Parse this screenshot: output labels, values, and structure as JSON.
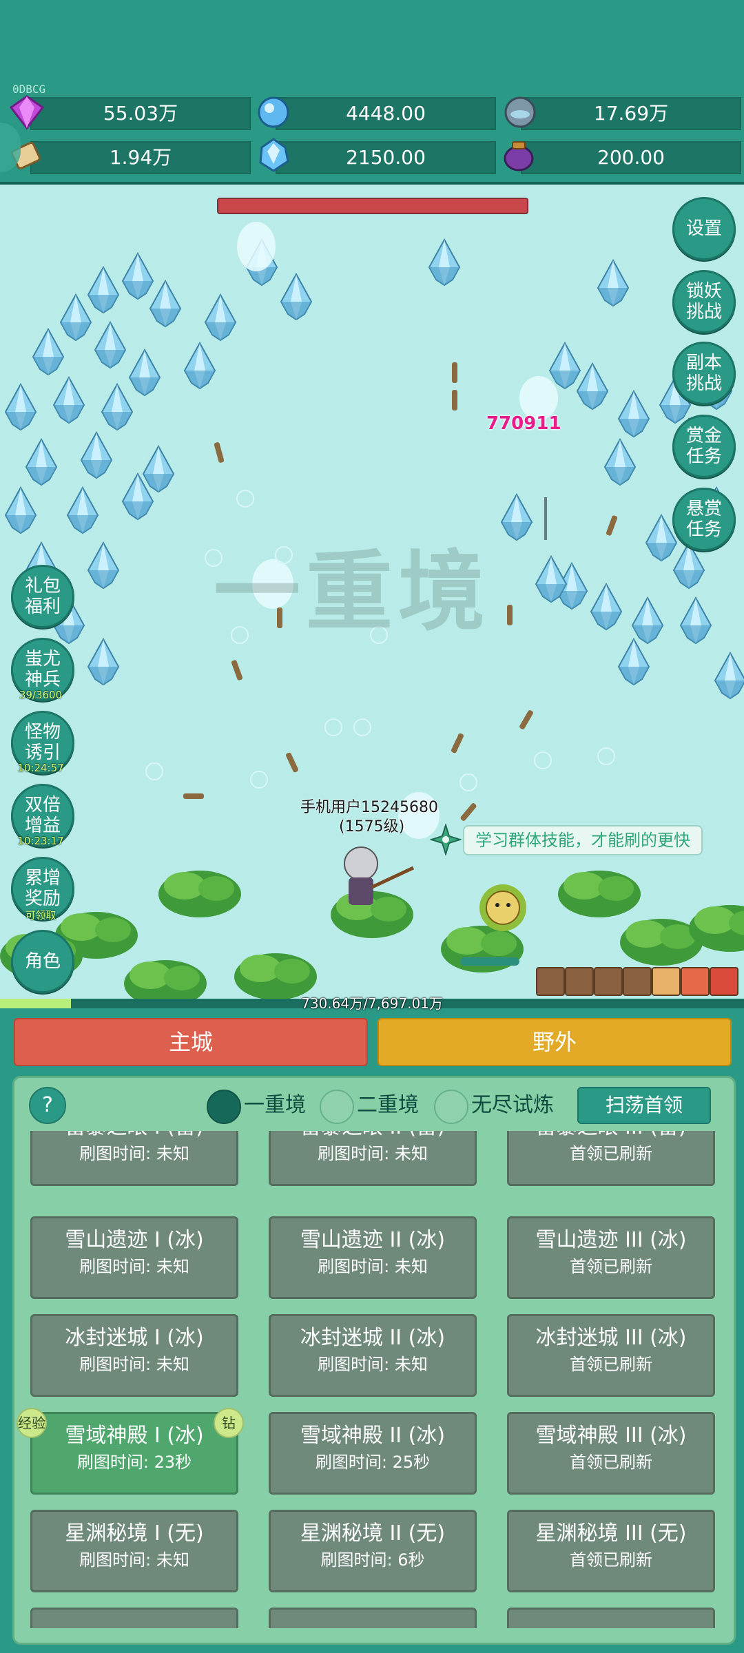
{
  "debug": {
    "fps_label": "0DBCG"
  },
  "resources": [
    {
      "icon": "purple-gem-icon",
      "value": "55.03万"
    },
    {
      "icon": "blue-crystal-icon",
      "value": "4448.00"
    },
    {
      "icon": "stone-orb-icon",
      "value": "17.69万"
    },
    {
      "icon": "scroll-icon",
      "value": "1.94万"
    },
    {
      "icon": "ice-shard-icon",
      "value": "2150.00"
    },
    {
      "icon": "purple-pot-icon",
      "value": "200.00"
    }
  ],
  "battle": {
    "realm_watermark": "一重境",
    "damage_number": "770911",
    "player_name": "手机用户15245680",
    "player_level": "(1575级)",
    "tip": "学习群体技能，才能刷的更快",
    "xp_text": "730.64万/7,697.01万",
    "xp_progress": 0.095
  },
  "right_buttons": [
    {
      "l1": "设置",
      "l2": ""
    },
    {
      "l1": "锁妖",
      "l2": "挑战"
    },
    {
      "l1": "副本",
      "l2": "挑战"
    },
    {
      "l1": "赏金",
      "l2": "任务"
    },
    {
      "l1": "悬赏",
      "l2": "任务"
    }
  ],
  "left_buttons": [
    {
      "l1": "礼包",
      "l2": "福利",
      "timer": ""
    },
    {
      "l1": "蚩尤",
      "l2": "神兵",
      "timer": "39/3600"
    },
    {
      "l1": "怪物",
      "l2": "诱引",
      "timer": "10:24:57"
    },
    {
      "l1": "双倍",
      "l2": "增益",
      "timer": "10:23:17"
    },
    {
      "l1": "累增",
      "l2": "奖励",
      "timer": "可领取"
    },
    {
      "l1": "角色",
      "l2": "",
      "timer": ""
    }
  ],
  "tabs": {
    "city": "主城",
    "wild": "野外"
  },
  "panel": {
    "help": "?",
    "options": [
      "一重境",
      "二重境",
      "无尽试炼"
    ],
    "selected_option": 0,
    "sweep_label": "扫荡首领",
    "tag_xp": "经验",
    "tag_diamond": "钻",
    "stages": [
      [
        {
          "name": "雷暴之眼 I (雷)",
          "status": "刷图时间: 未知"
        },
        {
          "name": "雷暴之眼 II (雷)",
          "status": "刷图时间: 未知"
        },
        {
          "name": "雷暴之眼 III (雷)",
          "status": "首领已刷新"
        }
      ],
      [
        {
          "name": "雪山遗迹 I (冰)",
          "status": "刷图时间: 未知"
        },
        {
          "name": "雪山遗迹 II (冰)",
          "status": "刷图时间: 未知"
        },
        {
          "name": "雪山遗迹 III (冰)",
          "status": "首领已刷新"
        }
      ],
      [
        {
          "name": "冰封迷城 I (冰)",
          "status": "刷图时间: 未知"
        },
        {
          "name": "冰封迷城 II (冰)",
          "status": "刷图时间: 未知"
        },
        {
          "name": "冰封迷城 III (冰)",
          "status": "首领已刷新"
        }
      ],
      [
        {
          "name": "雪域神殿 I (冰)",
          "status": "刷图时间: 23秒"
        },
        {
          "name": "雪域神殿 II (冰)",
          "status": "刷图时间: 25秒"
        },
        {
          "name": "雪域神殿 III (冰)",
          "status": "首领已刷新"
        }
      ],
      [
        {
          "name": "星渊秘境 I (无)",
          "status": "刷图时间: 未知"
        },
        {
          "name": "星渊秘境 II (无)",
          "status": "刷图时间: 6秒"
        },
        {
          "name": "星渊秘境 III (无)",
          "status": "首领已刷新"
        }
      ]
    ]
  }
}
